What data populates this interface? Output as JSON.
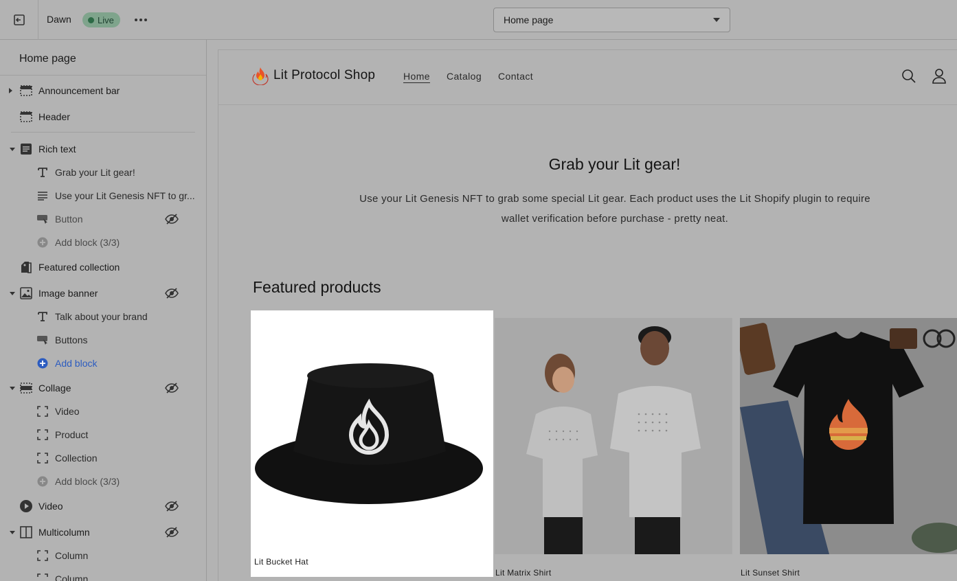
{
  "topbar": {
    "theme_name": "Dawn",
    "live_label": "Live",
    "page_select_value": "Home page"
  },
  "sidebar": {
    "title": "Home page",
    "sections": [
      {
        "label": "Announcement bar",
        "icon": "layout-bar-icon",
        "toggle": "collapsed"
      },
      {
        "label": "Header",
        "icon": "layout-header-icon",
        "toggle": "none"
      },
      {
        "label": "Rich text",
        "icon": "text-block-icon",
        "toggle": "expanded"
      },
      {
        "label": "Grab your Lit gear!",
        "icon": "text-t-icon",
        "sub": true
      },
      {
        "label": "Use your Lit Genesis NFT to gr...",
        "icon": "paragraph-icon",
        "sub": true
      },
      {
        "label": "Button",
        "icon": "button-icon",
        "sub": true,
        "hidden": true,
        "muted": true
      },
      {
        "label": "Add block (3/3)",
        "icon": "plus-circle-icon",
        "sub": true,
        "muted": true
      },
      {
        "label": "Featured collection",
        "icon": "collection-icon",
        "toggle": "none"
      },
      {
        "label": "Image banner",
        "icon": "image-icon",
        "toggle": "expanded",
        "hidden": true
      },
      {
        "label": "Talk about your brand",
        "icon": "text-t-icon",
        "sub": true
      },
      {
        "label": "Buttons",
        "icon": "button-icon",
        "sub": true
      },
      {
        "label": "Add block",
        "icon": "plus-circle-icon",
        "sub": true,
        "blue": true
      },
      {
        "label": "Collage",
        "icon": "collage-icon",
        "toggle": "expanded",
        "hidden": true
      },
      {
        "label": "Video",
        "icon": "dashed-square-icon",
        "sub": true
      },
      {
        "label": "Product",
        "icon": "dashed-square-icon",
        "sub": true
      },
      {
        "label": "Collection",
        "icon": "dashed-square-icon",
        "sub": true
      },
      {
        "label": "Add block (3/3)",
        "icon": "plus-circle-icon",
        "sub": true,
        "muted": true
      },
      {
        "label": "Video",
        "icon": "play-circle-icon",
        "toggle": "none",
        "hidden": true
      },
      {
        "label": "Multicolumn",
        "icon": "columns-icon",
        "toggle": "expanded",
        "hidden": true
      },
      {
        "label": "Column",
        "icon": "dashed-square-icon",
        "sub": true
      },
      {
        "label": "Column",
        "icon": "dashed-square-icon",
        "sub": true
      }
    ]
  },
  "shop": {
    "name": "Lit Protocol Shop",
    "nav": [
      "Home",
      "Catalog",
      "Contact"
    ],
    "active_nav": "Home"
  },
  "rich_text": {
    "heading": "Grab your Lit gear!",
    "body": "Use your Lit Genesis NFT to grab some special Lit gear. Each product uses the Lit Shopify plugin to require wallet verification before purchase - pretty neat."
  },
  "featured": {
    "heading": "Featured products",
    "products": [
      {
        "name": "Lit Bucket Hat",
        "highlighted": true
      },
      {
        "name": "Lit Matrix Shirt",
        "highlighted": false
      },
      {
        "name": "Lit Sunset Shirt",
        "highlighted": false
      }
    ]
  },
  "colors": {
    "overlay_gray": "#b3b3b3",
    "live_badge": "#7fa48c",
    "add_block_blue": "#2c5cc0",
    "flame_orange": "#e8542a"
  }
}
